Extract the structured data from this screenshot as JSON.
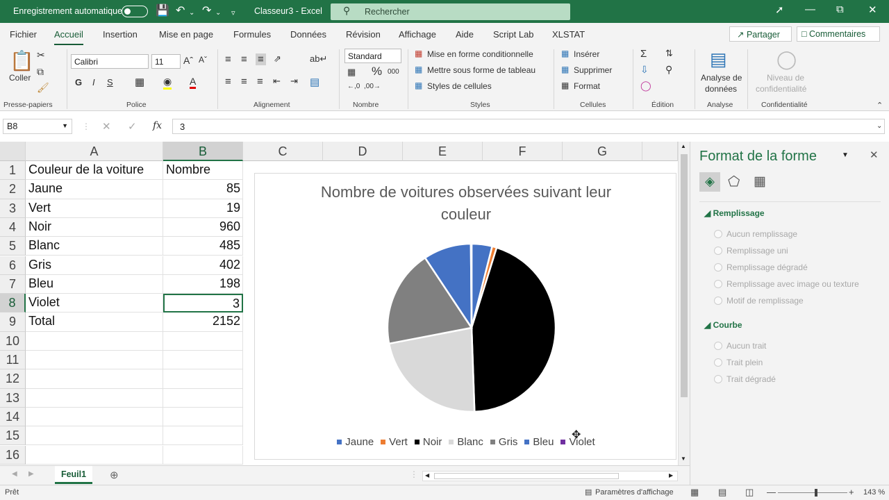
{
  "titlebar": {
    "autosave_label": "Enregistrement automatique",
    "doc_title": "Classeur3  -  Excel",
    "search_placeholder": "Rechercher"
  },
  "tabs": [
    "Fichier",
    "Accueil",
    "Insertion",
    "Mise en page",
    "Formules",
    "Données",
    "Révision",
    "Affichage",
    "Aide",
    "Script Lab",
    "XLSTAT"
  ],
  "active_tab": "Accueil",
  "share_label": "Partager",
  "comments_label": "Commentaires",
  "ribbon": {
    "paste_label": "Coller",
    "font_name": "Calibri",
    "font_size": "11",
    "number_format": "Standard",
    "cond_format": "Mise en forme conditionnelle",
    "table_format": "Mettre sous forme de tableau",
    "cell_styles": "Styles de cellules",
    "insert": "Insérer",
    "delete": "Supprimer",
    "format": "Format",
    "analyze_line1": "Analyse de",
    "analyze_line2": "données",
    "conf_line1": "Niveau de",
    "conf_line2": "confidentialité",
    "groups": [
      "Presse-papiers",
      "Police",
      "Alignement",
      "Nombre",
      "Styles",
      "Cellules",
      "Édition",
      "Analyse",
      "Confidentialité"
    ]
  },
  "formula_bar": {
    "name_box": "B8",
    "fx": "fx",
    "value": "3"
  },
  "columns": [
    "A",
    "B",
    "C",
    "D",
    "E",
    "F",
    "G"
  ],
  "rows": [
    "1",
    "2",
    "3",
    "4",
    "5",
    "6",
    "7",
    "8",
    "9",
    "10",
    "11",
    "12",
    "13",
    "14",
    "15",
    "16"
  ],
  "cells": {
    "headers": [
      "Couleur de la voiture",
      "Nombre"
    ],
    "data": [
      [
        "Jaune",
        "85"
      ],
      [
        "Vert",
        "19"
      ],
      [
        "Noir",
        "960"
      ],
      [
        "Blanc",
        "485"
      ],
      [
        "Gris",
        "402"
      ],
      [
        "Bleu",
        "198"
      ],
      [
        "Violet",
        "3"
      ],
      [
        "Total",
        "2152"
      ]
    ]
  },
  "chart_data": {
    "type": "pie",
    "title": "Nombre de voitures observées suivant leur couleur",
    "title_line1": "Nombre de voitures observées suivant leur",
    "title_line2": "couleur",
    "categories": [
      "Jaune",
      "Vert",
      "Noir",
      "Blanc",
      "Gris",
      "Bleu",
      "Violet"
    ],
    "values": [
      85,
      19,
      960,
      485,
      402,
      198,
      3
    ],
    "colors": [
      "#4472C4",
      "#ED7D31",
      "#000000",
      "#D9D9D9",
      "#808080",
      "#4472C4",
      "#7030A0"
    ],
    "legend_position": "bottom"
  },
  "sheet_tab": "Feuil1",
  "status": {
    "ready": "Prêt",
    "display_settings": "Paramètres d'affichage",
    "zoom": "143 %"
  },
  "pane": {
    "title": "Format de la forme",
    "fill_section": "Remplissage",
    "fill_options": [
      "Aucun remplissage",
      "Remplissage uni",
      "Remplissage dégradé",
      "Remplissage avec image ou texture",
      "Motif de remplissage"
    ],
    "line_section": "Courbe",
    "line_options": [
      "Aucun trait",
      "Trait plein",
      "Trait dégradé"
    ]
  }
}
